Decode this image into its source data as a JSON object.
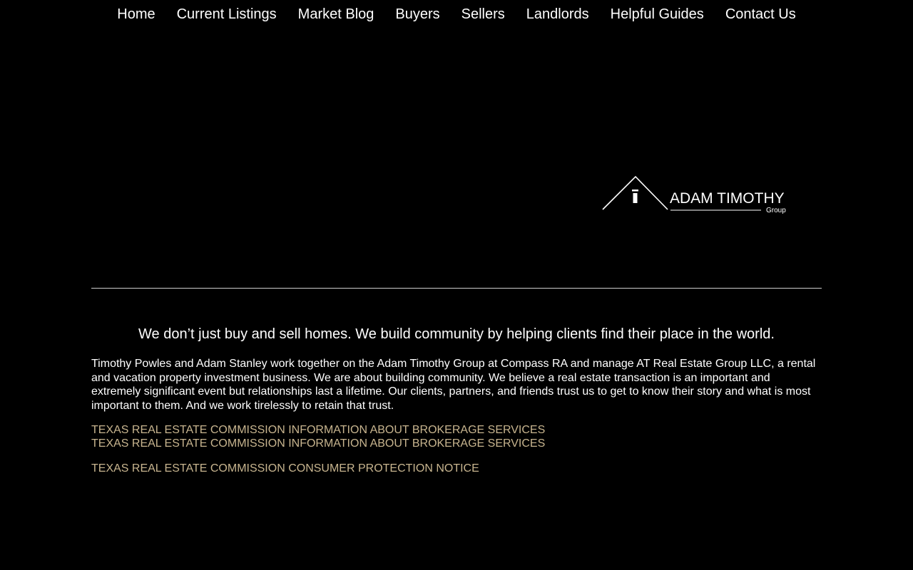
{
  "nav": {
    "items": [
      {
        "label": "Home"
      },
      {
        "label": "Current Listings"
      },
      {
        "label": "Market Blog"
      },
      {
        "label": "Buyers"
      },
      {
        "label": "Sellers"
      },
      {
        "label": "Landlords"
      },
      {
        "label": "Helpful Guides"
      },
      {
        "label": "Contact Us"
      }
    ]
  },
  "logo": {
    "name": "ADAM TIMOTHY",
    "sub": "Group",
    "icon": "house-roof-icon"
  },
  "content": {
    "tagline": "We don’t just buy and sell homes. We build community by helping clients find their place in the world.",
    "about": "Timothy Powles and Adam Stanley work together on the Adam Timothy Group at Compass RA and manage AT Real Estate Group LLC, a rental and vacation property investment business. We are about building community. We believe a real estate transaction is an important and extremely significant event but relationships last a lifetime. Our clients, partners, and friends trust us to get to know their story and what is most important to them.  And we work tirelessly to retain that trust."
  },
  "links": {
    "brokerage_1": "TEXAS REAL ESTATE COMMISSION INFORMATION ABOUT BROKERAGE SERVICES",
    "brokerage_2": "TEXAS REAL ESTATE COMMISSION INFORMATION ABOUT BROKERAGE SERVICES",
    "consumer": "TEXAS REAL ESTATE COMMISSION CONSUMER PROTECTION NOTICE"
  },
  "colors": {
    "background": "#000000",
    "text": "#ffffff",
    "link": "#c8b58f",
    "divider": "#cfcfcf"
  }
}
